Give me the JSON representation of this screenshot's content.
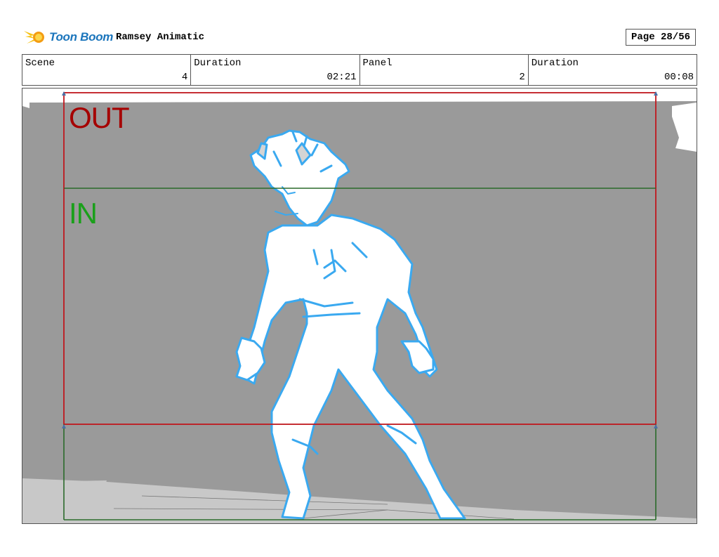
{
  "header": {
    "brand": "Toon Boom",
    "project_title": "Ramsey Animatic",
    "page": "Page 28/56"
  },
  "info": [
    {
      "label": "Scene",
      "value": "4"
    },
    {
      "label": "Duration",
      "value": "02:21"
    },
    {
      "label": "Panel",
      "value": "2"
    },
    {
      "label": "Duration",
      "value": "00:08"
    }
  ],
  "panel": {
    "out_label": "OUT",
    "in_label": "IN",
    "colors": {
      "background": "#9a9a9a",
      "out_frame": "#c0171e",
      "in_frame": "#2a6a2a",
      "sketch_line": "#3aa9f0"
    }
  }
}
